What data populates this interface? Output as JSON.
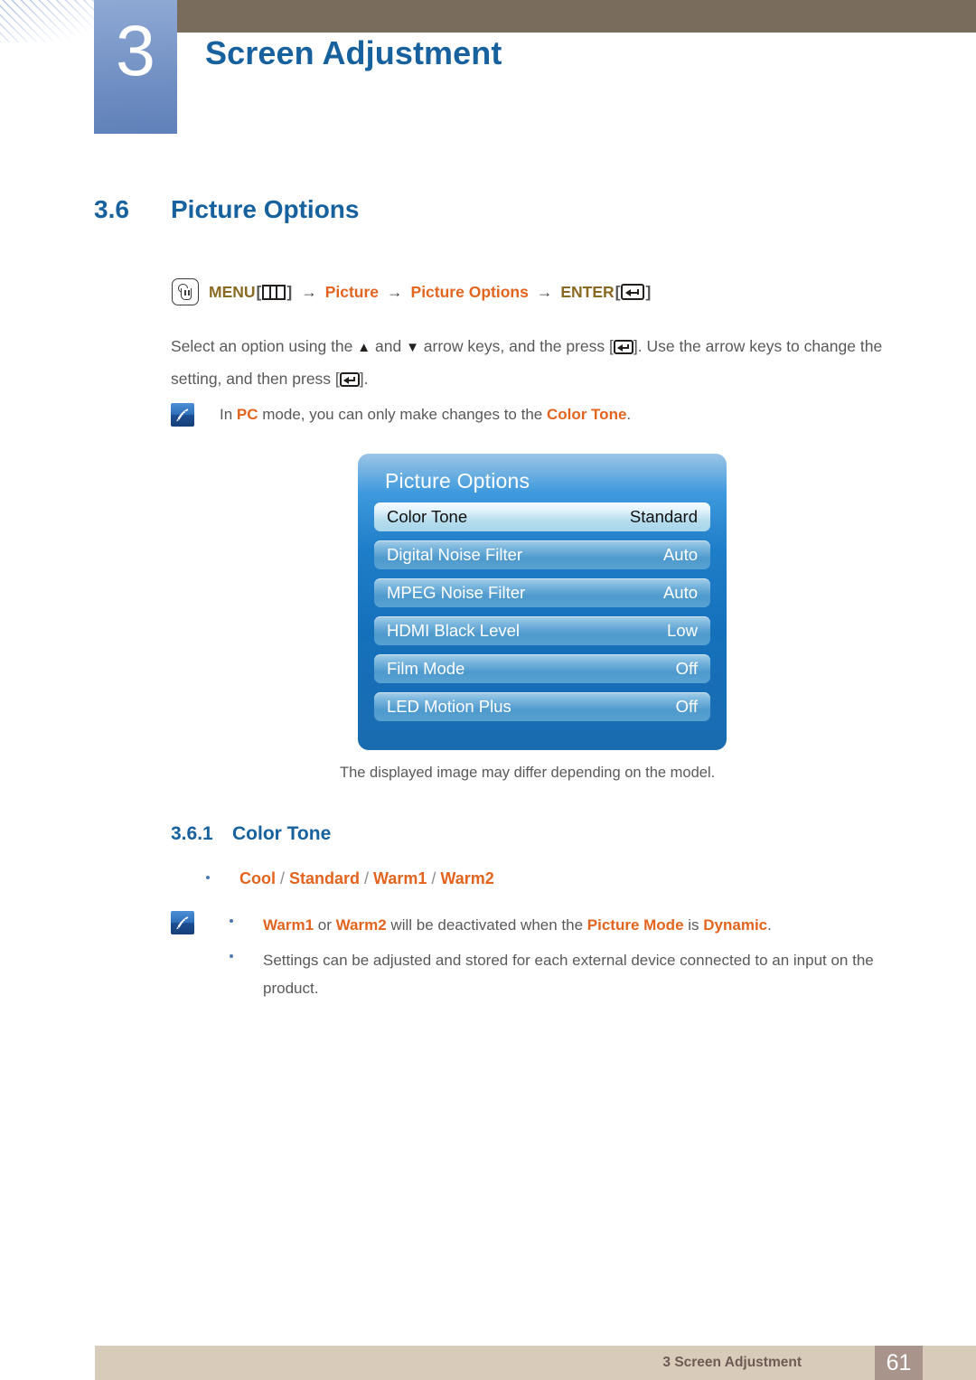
{
  "header": {
    "chapter_number": "3",
    "chapter_title": "Screen Adjustment"
  },
  "section": {
    "number": "3.6",
    "title": "Picture Options"
  },
  "nav_path": {
    "hand_icon": "hand-pointer-icon",
    "menu_label": "MENU",
    "menu_icon": "menu-bars-icon",
    "arrow1": "→",
    "step1": "Picture",
    "arrow2": "→",
    "step2": "Picture Options",
    "arrow3": "→",
    "enter_label": "ENTER",
    "enter_icon": "enter-return-icon",
    "bracket_open": "[",
    "bracket_close": "]"
  },
  "instructions": {
    "part1": "Select an option using the ",
    "up_arrow": "▲",
    "part2": " and ",
    "down_arrow": "▼",
    "part3": " arrow keys, and the press [",
    "part4": "]. Use the arrow keys to change the setting, and then press [",
    "part5": "]."
  },
  "note_pc": {
    "icon": "note-pen-icon",
    "prefix": "In ",
    "kw1": "PC",
    "middle": " mode, you can only make changes to the ",
    "kw2": "Color Tone",
    "suffix": "."
  },
  "osd": {
    "title": "Picture Options",
    "rows": [
      {
        "label": "Color Tone",
        "value": "Standard",
        "selected": true
      },
      {
        "label": "Digital Noise Filter",
        "value": "Auto",
        "selected": false
      },
      {
        "label": "MPEG Noise Filter",
        "value": "Auto",
        "selected": false
      },
      {
        "label": "HDMI Black Level",
        "value": "Low",
        "selected": false
      },
      {
        "label": "Film Mode",
        "value": "Off",
        "selected": false
      },
      {
        "label": "LED Motion Plus",
        "value": "Off",
        "selected": false
      }
    ],
    "caption": "The displayed image may differ depending on the model."
  },
  "subsection": {
    "number": "3.6.1",
    "title": "Color Tone",
    "options": [
      "Cool",
      "Standard",
      "Warm1",
      "Warm2"
    ],
    "separator": "/"
  },
  "notes_bottom": {
    "icon": "note-pen-icon",
    "item1": {
      "kw1": "Warm1",
      "mid1": " or ",
      "kw2": "Warm2",
      "mid2": " will be deactivated when the ",
      "kw3": "Picture Mode",
      "mid3": " is ",
      "kw4": "Dynamic",
      "end": "."
    },
    "item2": "Settings can be adjusted and stored for each external device connected to an input on the product."
  },
  "footer": {
    "label": "3 Screen Adjustment",
    "page": "61"
  },
  "colors": {
    "brand_blue": "#16619e",
    "accent_orange": "#e2641e",
    "olive": "#8a6a22",
    "header_brown": "#7a6c5d",
    "footer_beige": "#d8cbba",
    "footer_page_brown": "#a8948b",
    "tab_blue": "#6b8bc0"
  }
}
